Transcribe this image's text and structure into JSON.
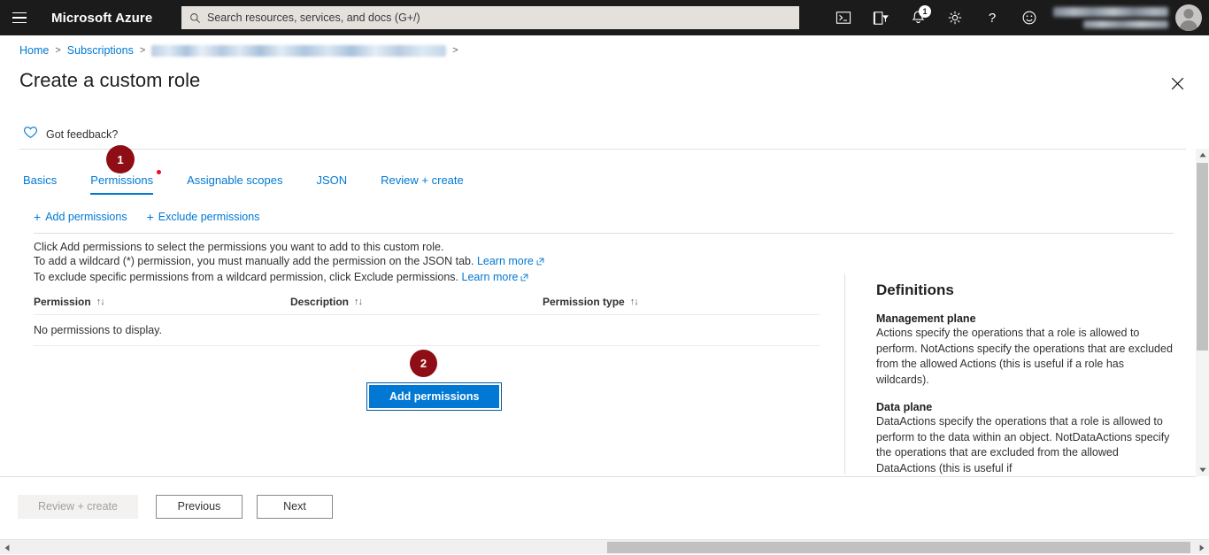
{
  "topbar": {
    "menu_icon": "hamburger-icon",
    "brand": "Microsoft Azure",
    "search": {
      "placeholder": "Search resources, services, and docs (G+/)",
      "value": "",
      "icon": "search-icon"
    },
    "icons": [
      {
        "name": "cloud-shell-icon",
        "glyph": ">_"
      },
      {
        "name": "directory-filter-icon",
        "glyph": "filter"
      },
      {
        "name": "notifications-bell-icon",
        "glyph": "bell",
        "badge": "1"
      },
      {
        "name": "settings-gear-icon",
        "glyph": "gear"
      },
      {
        "name": "help-question-icon",
        "glyph": "?"
      },
      {
        "name": "feedback-smiley-icon",
        "glyph": "smiley"
      }
    ],
    "account": {
      "name_redacted": true,
      "avatar": "user-avatar"
    }
  },
  "breadcrumb": {
    "items": [
      {
        "label": "Home",
        "link": true
      },
      {
        "label": "Subscriptions",
        "link": true
      },
      {
        "label": "",
        "redacted": true
      }
    ],
    "separator": ">"
  },
  "page": {
    "title": "Create a custom role",
    "close_label": "✕"
  },
  "feedback": {
    "icon": "heart-icon",
    "label": "Got feedback?"
  },
  "tabs": [
    {
      "label": "Basics",
      "selected": false
    },
    {
      "label": "Permissions",
      "selected": true,
      "dot": true
    },
    {
      "label": "Assignable scopes",
      "selected": false
    },
    {
      "label": "JSON",
      "selected": false
    },
    {
      "label": "Review + create",
      "selected": false
    }
  ],
  "commandbar": [
    {
      "icon": "plus-icon",
      "label": "Add permissions"
    },
    {
      "icon": "plus-icon",
      "label": "Exclude permissions"
    }
  ],
  "info": {
    "line1": "Click Add permissions to select the permissions you want to add to this custom role.",
    "line2_pre": "To add a wildcard (*) permission, you must manually add the permission on the JSON tab.",
    "line2_link": "Learn more",
    "line3_pre": "To exclude specific permissions from a wildcard permission, click Exclude permissions.",
    "line3_link": "Learn more"
  },
  "table": {
    "columns": [
      {
        "label": "Permission",
        "sort": "↑↓"
      },
      {
        "label": "Description",
        "sort": "↑↓"
      },
      {
        "label": "Permission type",
        "sort": "↑↓"
      }
    ],
    "empty_message": "No permissions to display."
  },
  "primary_action": {
    "label": "Add permissions",
    "focused": true
  },
  "definitions": {
    "title": "Definitions",
    "sections": [
      {
        "heading": "Management plane",
        "body": "Actions specify the operations that a role is allowed to perform. NotActions specify the operations that are excluded from the allowed Actions (this is useful if a role has wildcards)."
      },
      {
        "heading": "Data plane",
        "body": "DataActions specify the operations that a role is allowed to perform to the data within an object. NotDataActions specify the operations that are excluded from the allowed DataActions (this is useful if"
      }
    ]
  },
  "footer": {
    "review_label": "Review + create",
    "review_disabled": true,
    "previous_label": "Previous",
    "next_label": "Next"
  },
  "annotations": [
    {
      "number": "1",
      "target": "tab-permissions"
    },
    {
      "number": "2",
      "target": "add-permissions-button"
    }
  ],
  "colors": {
    "topbar_bg": "#1b1b1b",
    "accent_blue": "#0078d4",
    "annotation_red": "#8f0e15",
    "tab_dot_red": "#e81123",
    "search_bg": "#e4e1dd"
  }
}
